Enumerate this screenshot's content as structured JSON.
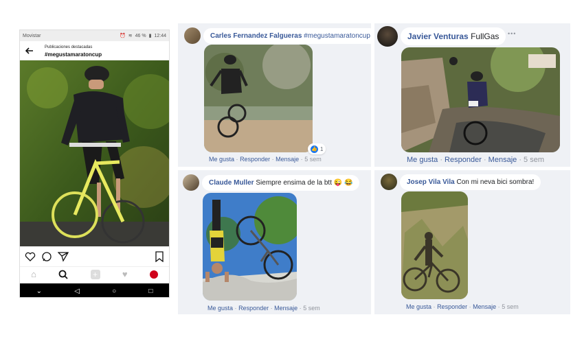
{
  "instagram": {
    "status_bar": {
      "carrier": "Movistar",
      "signal": "46 %",
      "time": "12:44"
    },
    "header": {
      "subtitle": "Publicaciones destacadas",
      "hashtag": "#megustamaratoncup"
    }
  },
  "posts": [
    {
      "author": "Carles Fernandez Falgueras",
      "text": "#megustamaratoncup",
      "reaction_count": "1",
      "actions": {
        "like": "Me gusta",
        "reply": "Responder",
        "message": "Mensaje",
        "time": "5 sem"
      }
    },
    {
      "author": "Javier Venturas",
      "text": "FullGas",
      "more": "•••",
      "actions": {
        "like": "Me gusta",
        "reply": "Responder",
        "message": "Mensaje",
        "time": "5 sem"
      }
    },
    {
      "author": "Claude Muller",
      "text": "Siempre ensima de la btt",
      "emoji": "😜 😂",
      "actions": {
        "like": "Me gusta",
        "reply": "Responder",
        "message": "Mensaje",
        "time": "5 sem"
      }
    },
    {
      "author": "Josep Vila Vila",
      "text": "Con mi neva bici sombra!",
      "actions": {
        "like": "Me gusta",
        "reply": "Responder",
        "message": "Mensaje",
        "time": "5 sem"
      }
    }
  ],
  "colors": {
    "fb_link": "#385898",
    "fb_bg": "#eff1f5",
    "meta": "#90949c",
    "like_blue": "#1877f2"
  }
}
